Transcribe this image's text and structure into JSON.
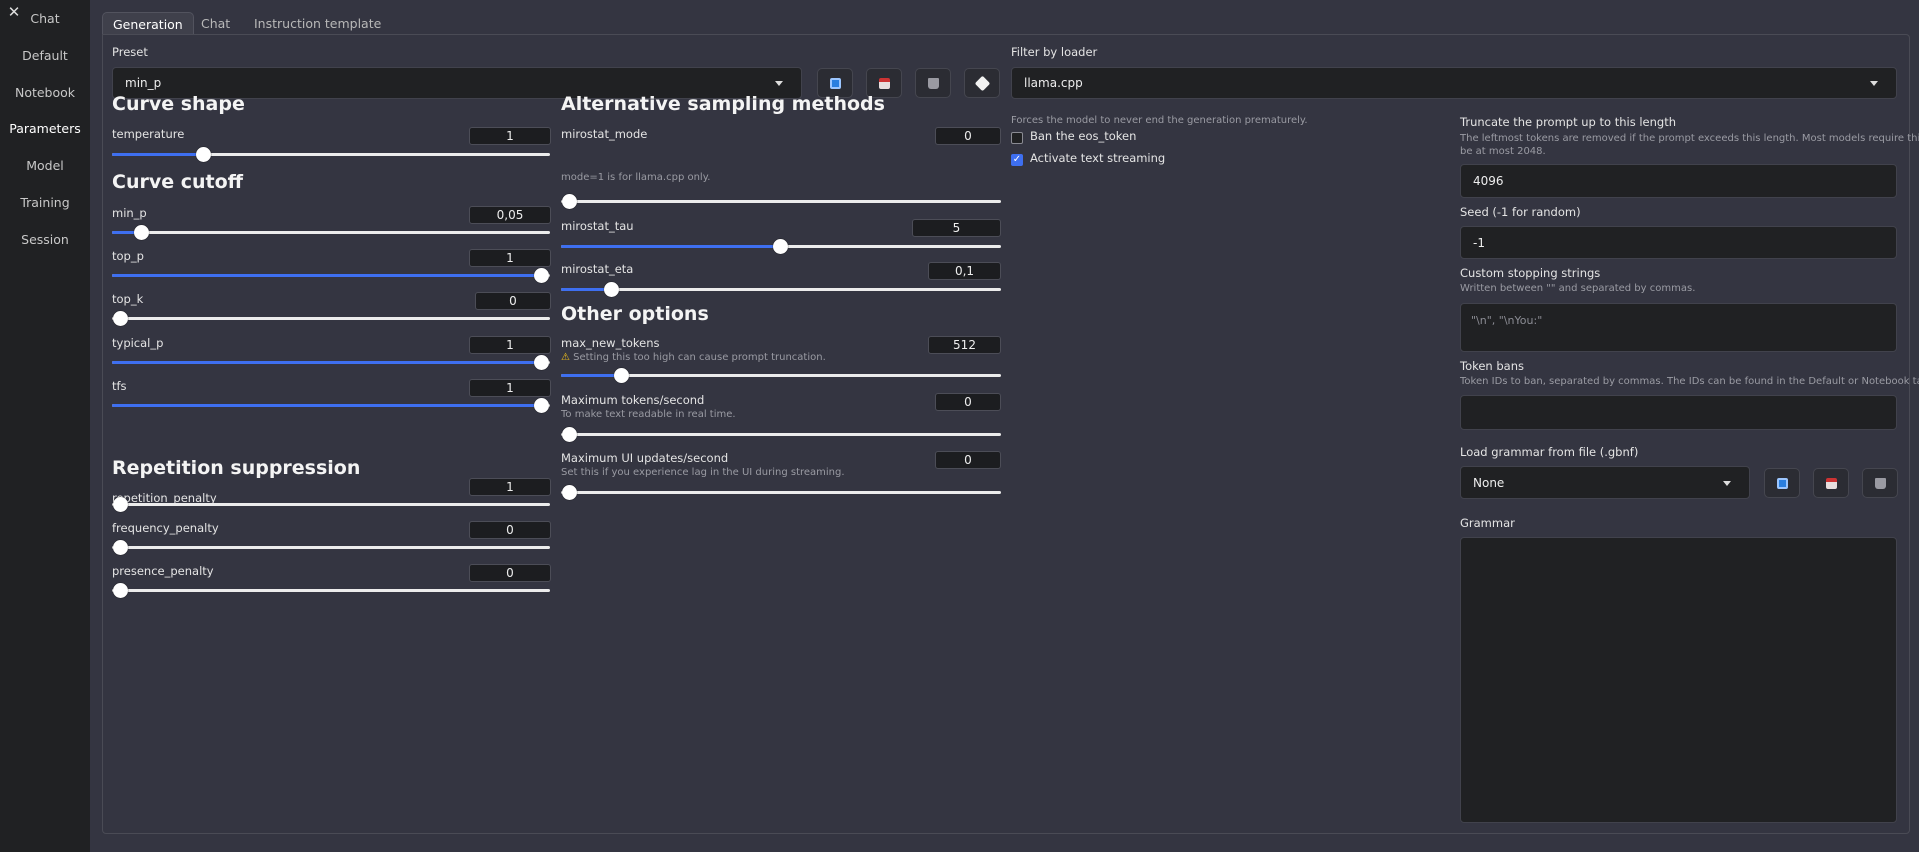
{
  "sidebar": {
    "close": "✕",
    "items": [
      "Chat",
      "Default",
      "Notebook",
      "Parameters",
      "Model",
      "Training",
      "Session"
    ]
  },
  "tabs": [
    "Generation",
    "Chat",
    "Instruction template"
  ],
  "preset": {
    "label": "Preset",
    "value": "min_p"
  },
  "loader": {
    "label": "Filter by loader",
    "value": "llama.cpp"
  },
  "curve_shape": {
    "title": "Curve shape",
    "temperature": {
      "label": "temperature",
      "value": "1"
    }
  },
  "curve_cutoff": {
    "title": "Curve cutoff",
    "items": [
      {
        "label": "min_p",
        "value": "0,05"
      },
      {
        "label": "top_p",
        "value": "1"
      },
      {
        "label": "top_k",
        "value": "0"
      },
      {
        "label": "typical_p",
        "value": "1"
      },
      {
        "label": "tfs",
        "value": "1"
      }
    ]
  },
  "repetition": {
    "title": "Repetition suppression",
    "items": [
      {
        "label": "repetition_penalty",
        "value": "1"
      },
      {
        "label": "frequency_penalty",
        "value": "0"
      },
      {
        "label": "presence_penalty",
        "value": "0"
      }
    ]
  },
  "alt": {
    "title": "Alternative sampling methods",
    "mirostat_mode": {
      "label": "mirostat_mode",
      "value": "0",
      "hint": "mode=1 is for llama.cpp only."
    },
    "mirostat_tau": {
      "label": "mirostat_tau",
      "value": "5"
    },
    "mirostat_eta": {
      "label": "mirostat_eta",
      "value": "0,1"
    }
  },
  "other": {
    "title": "Other options",
    "max_new_tokens": {
      "label": "max_new_tokens",
      "value": "512",
      "warning": "Setting this too high can cause prompt truncation."
    },
    "max_tps": {
      "label": "Maximum tokens/second",
      "value": "0",
      "hint": "To make text readable in real time."
    },
    "max_ui": {
      "label": "Maximum UI updates/second",
      "value": "0",
      "hint": "Set this if you experience lag in the UI during streaming."
    }
  },
  "flags": {
    "note": "Forces the model to never end the generation prematurely.",
    "ban_eos": "Ban the eos_token",
    "streaming": "Activate text streaming"
  },
  "truncate": {
    "label": "Truncate the prompt up to this length",
    "hint1": "The leftmost tokens are removed if the prompt exceeds this length. Most models require this to",
    "hint2": "be at most 2048.",
    "value": "4096"
  },
  "seed": {
    "label": "Seed (-1 for random)",
    "value": "-1"
  },
  "stop": {
    "label": "Custom stopping strings",
    "hint": "Written between \"\" and separated by commas.",
    "placeholder": "\"\\n\", \"\\nYou:\""
  },
  "bans": {
    "label": "Token bans",
    "hint": "Token IDs to ban, separated by commas. The IDs can be found in the Default or Notebook tab."
  },
  "grammar_file": {
    "label": "Load grammar from file (.gbnf)",
    "value": "None"
  },
  "grammar": {
    "label": "Grammar"
  },
  "colors": {
    "accent": "#3e6ff0",
    "save": "#e8dede",
    "refresh": "#2a7fe0"
  }
}
